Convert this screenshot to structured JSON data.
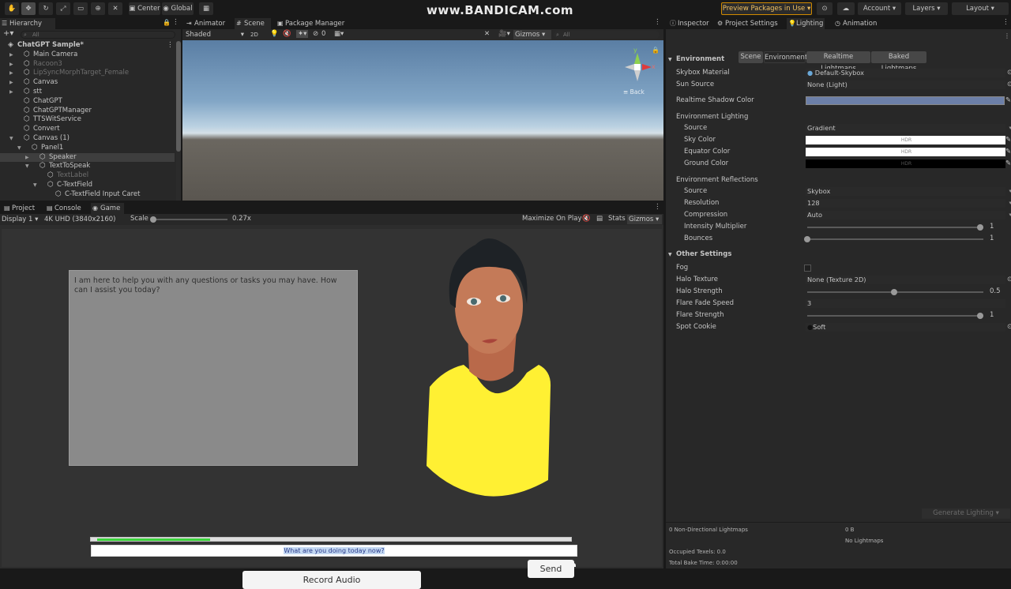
{
  "watermark": "www.BANDICAM.com",
  "toolbar": {
    "center": "Center",
    "global": "Global",
    "preview_packages": "Preview Packages in Use",
    "account": "Account",
    "layers": "Layers",
    "layout": "Layout"
  },
  "hierarchy": {
    "tab": "Hierarchy",
    "search_placeholder": "All",
    "items": [
      {
        "label": "ChatGPT Sample*",
        "depth": 0,
        "expanded": true,
        "scene": true
      },
      {
        "label": "Main Camera",
        "depth": 1,
        "arrow": true
      },
      {
        "label": "Racoon3",
        "depth": 1,
        "arrow": true,
        "dim": true
      },
      {
        "label": "LipSyncMorphTarget_Female",
        "depth": 1,
        "arrow": true,
        "dim": true
      },
      {
        "label": "Canvas",
        "depth": 1,
        "arrow": true
      },
      {
        "label": "stt",
        "depth": 1,
        "arrow": true
      },
      {
        "label": "ChatGPT",
        "depth": 1
      },
      {
        "label": "ChatGPTManager",
        "depth": 1
      },
      {
        "label": "TTSWitService",
        "depth": 1
      },
      {
        "label": "Convert",
        "depth": 1
      },
      {
        "label": "Canvas (1)",
        "depth": 1,
        "expanded": true
      },
      {
        "label": "Panel1",
        "depth": 2,
        "expanded": true
      },
      {
        "label": "Speaker",
        "depth": 3,
        "arrow": true,
        "selected": true
      },
      {
        "label": "TextToSpeak",
        "depth": 3,
        "expanded": true
      },
      {
        "label": "TextLabel",
        "depth": 4,
        "dim": true
      },
      {
        "label": "C-TextField",
        "depth": 4,
        "expanded": true
      },
      {
        "label": "C-TextField Input Caret",
        "depth": 5
      }
    ]
  },
  "scene_tabs": {
    "animator": "Animator",
    "scene": "Scene",
    "package_manager": "Package Manager"
  },
  "scene_toolbar": {
    "shaded": "Shaded",
    "two_d": "2D",
    "gizmos": "Gizmos",
    "search": "All",
    "fx_count": "0"
  },
  "gizmo": {
    "back": "≡ Back",
    "y": "y",
    "x": "x"
  },
  "bottom_tabs": {
    "project": "Project",
    "console": "Console",
    "game": "Game"
  },
  "game_toolbar": {
    "display": "Display 1",
    "resolution": "4K UHD (3840x2160)",
    "scale_label": "Scale",
    "scale_value": "0.27x",
    "maximize": "Maximize On Play",
    "stats": "Stats",
    "gizmos": "Gizmos"
  },
  "game": {
    "response_text": "I am here to help you with any questions or tasks you may have. How can I assist you today?",
    "progress_fraction": 0.24,
    "input_text": "What are you doing today now?",
    "send_label": "Send",
    "record_label": "Record Audio",
    "shirt_color": "#fff033",
    "panel_color": "#8a8a8a"
  },
  "right_tabs": {
    "inspector": "Inspector",
    "project_settings": "Project Settings",
    "lighting": "Lighting",
    "animation": "Animation"
  },
  "lighting": {
    "subtabs": [
      "Scene",
      "Environment",
      "Realtime Lightmaps",
      "Baked Lightmaps"
    ],
    "active_subtab": "Environment",
    "environment": {
      "header": "Environment",
      "skybox_material": {
        "label": "Skybox Material",
        "value": "Default-Skybox"
      },
      "sun_source": {
        "label": "Sun Source",
        "value": "None (Light)"
      },
      "realtime_shadow_color": {
        "label": "Realtime Shadow Color",
        "color": "#6c7fa8"
      },
      "env_lighting": "Environment Lighting",
      "source": {
        "label": "Source",
        "value": "Gradient"
      },
      "sky_color": {
        "label": "Sky Color",
        "hdr": "HDR",
        "color": "#ffffff"
      },
      "equator_color": {
        "label": "Equator Color",
        "hdr": "HDR",
        "color": "#ffffff"
      },
      "ground_color": {
        "label": "Ground Color",
        "hdr": "HDR",
        "color": "#000000"
      },
      "env_reflections": "Environment Reflections",
      "refl_source": {
        "label": "Source",
        "value": "Skybox"
      },
      "resolution": {
        "label": "Resolution",
        "value": "128"
      },
      "compression": {
        "label": "Compression",
        "value": "Auto"
      },
      "intensity": {
        "label": "Intensity Multiplier",
        "value": "1",
        "fraction": 1.0
      },
      "bounces": {
        "label": "Bounces",
        "value": "1",
        "fraction": 0.0
      }
    },
    "other": {
      "header": "Other Settings",
      "fog": {
        "label": "Fog"
      },
      "halo_texture": {
        "label": "Halo Texture",
        "value": "None (Texture 2D)"
      },
      "halo_strength": {
        "label": "Halo Strength",
        "value": "0.5",
        "fraction": 0.5
      },
      "flare_fade_speed": {
        "label": "Flare Fade Speed",
        "value": "3"
      },
      "flare_strength": {
        "label": "Flare Strength",
        "value": "1",
        "fraction": 1.0
      },
      "spot_cookie": {
        "label": "Spot Cookie",
        "value": "Soft"
      }
    },
    "generate": "Generate Lighting",
    "stats": {
      "non_directional": "0 Non-Directional Lightmaps",
      "size": "0 B",
      "no_lightmaps": "No Lightmaps",
      "occupied": "Occupied Texels: 0.0",
      "bake_time": "Total Bake Time: 0:00:00"
    }
  }
}
